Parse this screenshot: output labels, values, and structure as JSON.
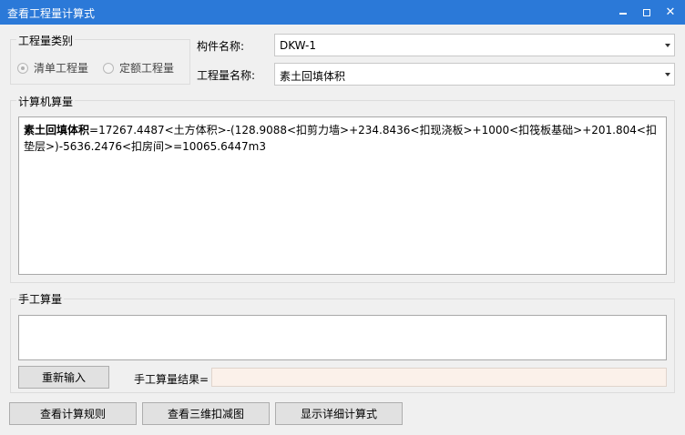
{
  "window": {
    "title": "查看工程量计算式",
    "controls": [
      "minimize-icon",
      "maximize-icon",
      "close-icon"
    ]
  },
  "quantity_type": {
    "legend": "工程量类别",
    "options": [
      {
        "label": "清单工程量",
        "selected": true
      },
      {
        "label": "定额工程量",
        "selected": false
      }
    ]
  },
  "component_name": {
    "label": "构件名称:",
    "value": "DKW-1"
  },
  "quantity_name": {
    "label": "工程量名称:",
    "value": "素土回填体积"
  },
  "computer_calc": {
    "legend": "计算机算量",
    "formula_name": "素土回填体积",
    "formula_body": "=17267.4487<土方体积>-(128.9088<扣剪力墙>+234.8436<扣现浇板>+1000<扣筏板基础>+201.804<扣垫层>)-5636.2476<扣房间>=10065.6447m3"
  },
  "manual_calc": {
    "legend": "手工算量",
    "input_value": "",
    "reenter_button": "重新输入",
    "result_label": "手工算量结果=",
    "result_value": ""
  },
  "footer": {
    "rules_button": "查看计算规则",
    "view3d_button": "查看三维扣减图",
    "detail_button": "显示详细计算式"
  }
}
